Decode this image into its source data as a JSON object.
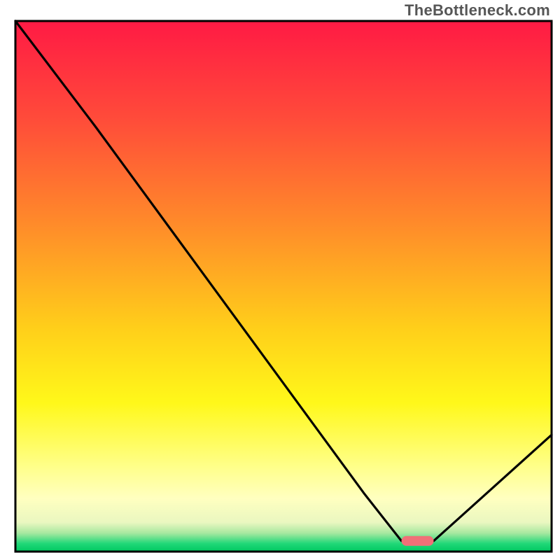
{
  "attribution": "TheBottleneck.com",
  "chart_data": {
    "type": "line",
    "title": "",
    "xlabel": "",
    "ylabel": "",
    "xlim": [
      0,
      100
    ],
    "ylim": [
      0,
      100
    ],
    "grid": false,
    "legend": false,
    "annotations": [],
    "series": [
      {
        "name": "bottleneck-curve",
        "color": "#000000",
        "x": [
          0,
          15,
          65,
          72,
          78,
          100
        ],
        "values": [
          100,
          80,
          11,
          2,
          2,
          22
        ],
        "note": "y is qualitative percentage of plot height from bottom; chart has no numeric axis labels"
      }
    ],
    "marker": {
      "name": "optimal-marker",
      "color": "#f07078",
      "x_center": 75,
      "width": 6,
      "y": 2
    },
    "background": {
      "type": "vertical-gradient",
      "stops": [
        {
          "pos": 0.0,
          "color": "#ff1a44"
        },
        {
          "pos": 0.18,
          "color": "#ff4a3a"
        },
        {
          "pos": 0.38,
          "color": "#ff8a2a"
        },
        {
          "pos": 0.58,
          "color": "#ffcf1a"
        },
        {
          "pos": 0.72,
          "color": "#fff81a"
        },
        {
          "pos": 0.84,
          "color": "#ffff8a"
        },
        {
          "pos": 0.9,
          "color": "#ffffc0"
        },
        {
          "pos": 0.945,
          "color": "#eaf7c0"
        },
        {
          "pos": 0.965,
          "color": "#a8e8a0"
        },
        {
          "pos": 0.985,
          "color": "#20d878"
        },
        {
          "pos": 1.0,
          "color": "#00c860"
        }
      ]
    },
    "frame": {
      "color": "#000000",
      "width": 3
    }
  }
}
